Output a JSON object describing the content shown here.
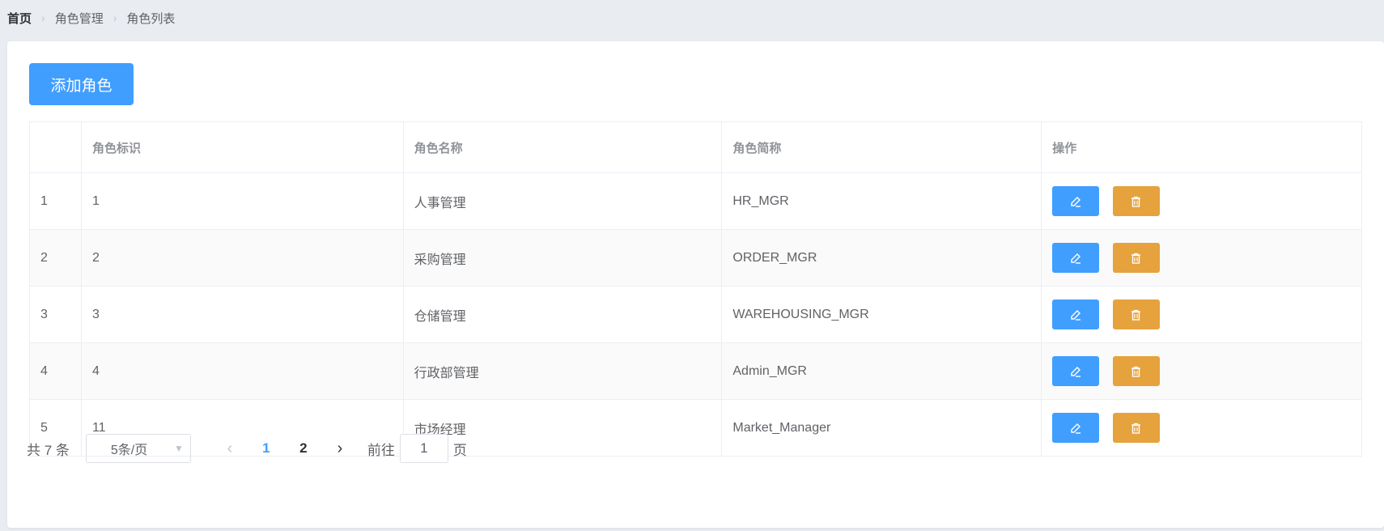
{
  "breadcrumb": [
    "首页",
    "角色管理",
    "角色列表"
  ],
  "toolbar": {
    "add_label": "添加角色"
  },
  "table": {
    "headers": [
      "",
      "角色标识",
      "角色名称",
      "角色简称",
      "操作"
    ],
    "rows": [
      {
        "idx": "1",
        "id": "1",
        "name": "人事管理",
        "code": "HR_MGR"
      },
      {
        "idx": "2",
        "id": "2",
        "name": "采购管理",
        "code": "ORDER_MGR"
      },
      {
        "idx": "3",
        "id": "3",
        "name": "仓储管理",
        "code": "WAREHOUSING_MGR"
      },
      {
        "idx": "4",
        "id": "4",
        "name": "行政部管理",
        "code": "Admin_MGR"
      },
      {
        "idx": "5",
        "id": "11",
        "name": "市场经理",
        "code": "Market_Manager"
      }
    ],
    "edit_icon": "edit-icon",
    "delete_icon": "delete-icon"
  },
  "pagination": {
    "total_label": "共 7 条",
    "page_size": "5条/页",
    "pages": [
      "1",
      "2"
    ],
    "current": "1",
    "goto_prefix": "前往",
    "goto_value": "1",
    "goto_suffix": "页"
  },
  "colors": {
    "primary": "#409eff",
    "warning": "#e6a23c",
    "background": "#e9edf2"
  }
}
